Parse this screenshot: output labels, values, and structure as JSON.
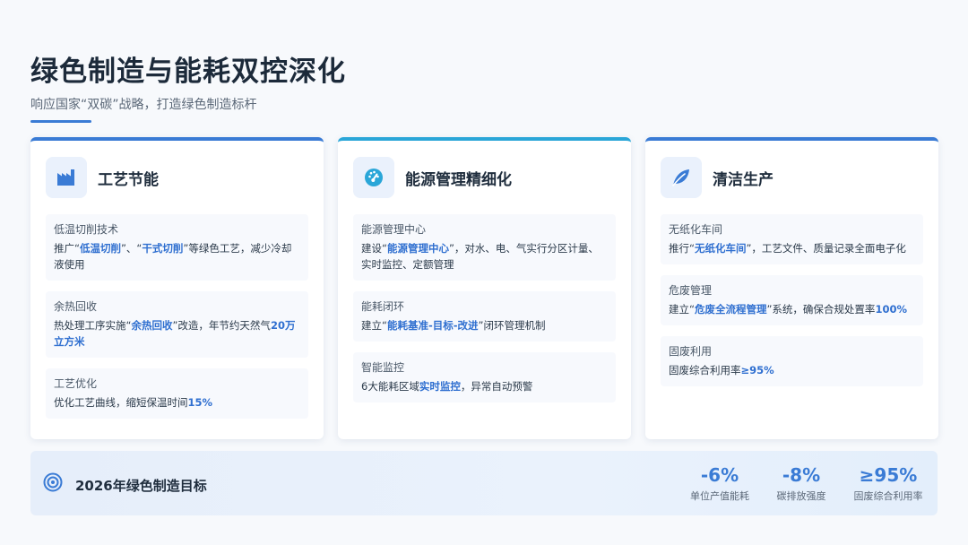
{
  "header": {
    "title": "绿色制造与能耗双控深化",
    "subtitle": "响应国家“双碳”战略，打造绿色制造标杆"
  },
  "cards": [
    {
      "title": "工艺节能",
      "icon": "factory-icon",
      "items": [
        {
          "label": "低温切削技术",
          "desc": [
            {
              "t": "推广“"
            },
            {
              "t": "低温切削",
              "h": true
            },
            {
              "t": "”、“"
            },
            {
              "t": "干式切削",
              "h": true
            },
            {
              "t": "”等绿色工艺，减少冷却液使用"
            }
          ]
        },
        {
          "label": "余热回收",
          "desc": [
            {
              "t": "热处理工序实施“"
            },
            {
              "t": "余热回收",
              "h": true
            },
            {
              "t": "”改造，年节约天然气"
            },
            {
              "t": "20万立方米",
              "h": true
            }
          ]
        },
        {
          "label": "工艺优化",
          "desc": [
            {
              "t": "优化工艺曲线，缩短保温时间"
            },
            {
              "t": "15%",
              "h": true
            }
          ]
        }
      ]
    },
    {
      "title": "能源管理精细化",
      "icon": "gauge-icon",
      "items": [
        {
          "label": "能源管理中心",
          "desc": [
            {
              "t": "建设“"
            },
            {
              "t": "能源管理中心",
              "h": true
            },
            {
              "t": "”，对水、电、气实行分区计量、实时监控、定额管理"
            }
          ]
        },
        {
          "label": "能耗闭环",
          "desc": [
            {
              "t": "建立“"
            },
            {
              "t": "能耗基准-目标-改进",
              "h": true
            },
            {
              "t": "”闭环管理机制"
            }
          ]
        },
        {
          "label": "智能监控",
          "desc": [
            {
              "t": "6大能耗区域"
            },
            {
              "t": "实时监控",
              "h": true
            },
            {
              "t": "，异常自动预警"
            }
          ]
        }
      ]
    },
    {
      "title": "清洁生产",
      "icon": "leaf-icon",
      "items": [
        {
          "label": "无纸化车间",
          "desc": [
            {
              "t": "推行“"
            },
            {
              "t": "无纸化车间",
              "h": true
            },
            {
              "t": "”，工艺文件、质量记录全面电子化"
            }
          ]
        },
        {
          "label": "危废管理",
          "desc": [
            {
              "t": "建立“"
            },
            {
              "t": "危废全流程管理",
              "h": true
            },
            {
              "t": "”系统，确保合规处置率"
            },
            {
              "t": "100%",
              "h": true
            }
          ]
        },
        {
          "label": "固废利用",
          "desc": [
            {
              "t": "固废综合利用率"
            },
            {
              "t": "≥95%",
              "h": true
            }
          ]
        }
      ]
    }
  ],
  "goal": {
    "title": "2026年绿色制造目标",
    "icon": "target-icon",
    "metrics": [
      {
        "value": "-6%",
        "label": "单位产值能耗"
      },
      {
        "value": "-8%",
        "label": "碳排放强度"
      },
      {
        "value": "≥95%",
        "label": "固废综合利用率"
      }
    ]
  },
  "colors": {
    "accent": "#3a7bd5",
    "accent2": "#2aa6d8",
    "highlight": "#2f6fd0"
  }
}
